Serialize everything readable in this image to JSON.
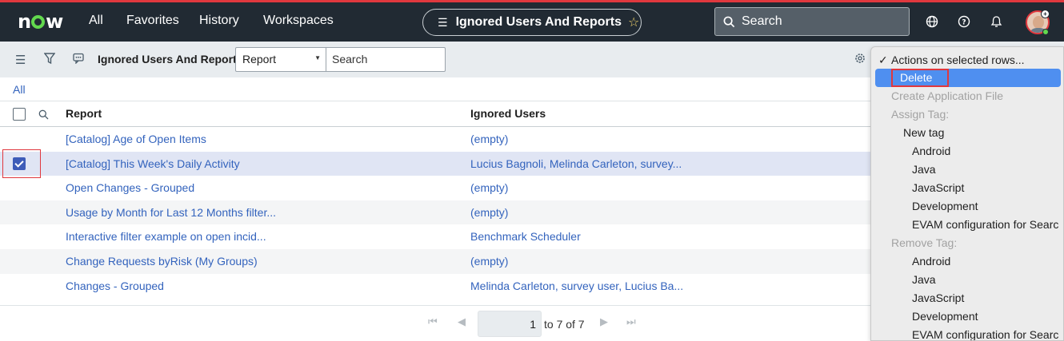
{
  "nav": {
    "logo": "now",
    "links": [
      "All",
      "Favorites",
      "History",
      "Workspaces"
    ],
    "title": "Ignored Users And Reports",
    "search_label": "Search",
    "icons": [
      "globe-icon",
      "help-icon",
      "bell-icon"
    ]
  },
  "toolbar": {
    "list_title": "Ignored Users And Reports",
    "field_select": "Report",
    "search_placeholder": "Search"
  },
  "breadcrumb": "All",
  "table": {
    "columns": [
      "Report",
      "Ignored Users"
    ],
    "rows": [
      {
        "report": "[Catalog] Age of Open Items",
        "users": "(empty)",
        "checked": false
      },
      {
        "report": "[Catalog] This Week's Daily Activity",
        "users": "Lucius Bagnoli, Melinda Carleton, survey...",
        "checked": true
      },
      {
        "report": "Open Changes - Grouped",
        "users": "(empty)",
        "checked": false
      },
      {
        "report": "Usage by Month for Last 12 Months filter...",
        "users": "(empty)",
        "checked": false
      },
      {
        "report": "Interactive filter example on open incid...",
        "users": "Benchmark Scheduler",
        "checked": false
      },
      {
        "report": "Change Requests byRisk (My Groups)",
        "users": "(empty)",
        "checked": false
      },
      {
        "report": "Changes - Grouped",
        "users": "Melinda Carleton, survey user, Lucius Ba...",
        "checked": false
      }
    ]
  },
  "pager": {
    "current": "1",
    "range_text": "to 7 of 7"
  },
  "menu": {
    "items": [
      {
        "label": "Actions on selected rows...",
        "kind": "check"
      },
      {
        "label": "Delete",
        "kind": "highlight"
      },
      {
        "label": "Create Application File",
        "kind": "disabled"
      },
      {
        "label": "Assign Tag:",
        "kind": "disabled"
      },
      {
        "label": "New tag",
        "kind": "level1"
      },
      {
        "label": "Android",
        "kind": "level2"
      },
      {
        "label": "Java",
        "kind": "level2"
      },
      {
        "label": "JavaScript",
        "kind": "level2"
      },
      {
        "label": "Development",
        "kind": "level2"
      },
      {
        "label": "EVAM configuration for Searc",
        "kind": "level2"
      },
      {
        "label": "Remove Tag:",
        "kind": "disabled"
      },
      {
        "label": "Android",
        "kind": "level2"
      },
      {
        "label": "Java",
        "kind": "level2"
      },
      {
        "label": "JavaScript",
        "kind": "level2"
      },
      {
        "label": "Development",
        "kind": "level2"
      },
      {
        "label": "EVAM configuration for Searc",
        "kind": "level2"
      }
    ]
  },
  "colors": {
    "nav_bg": "#212a33",
    "accent_red": "#e0383e",
    "link_blue": "#3363bd",
    "menu_highlight": "#4f8ff0"
  }
}
